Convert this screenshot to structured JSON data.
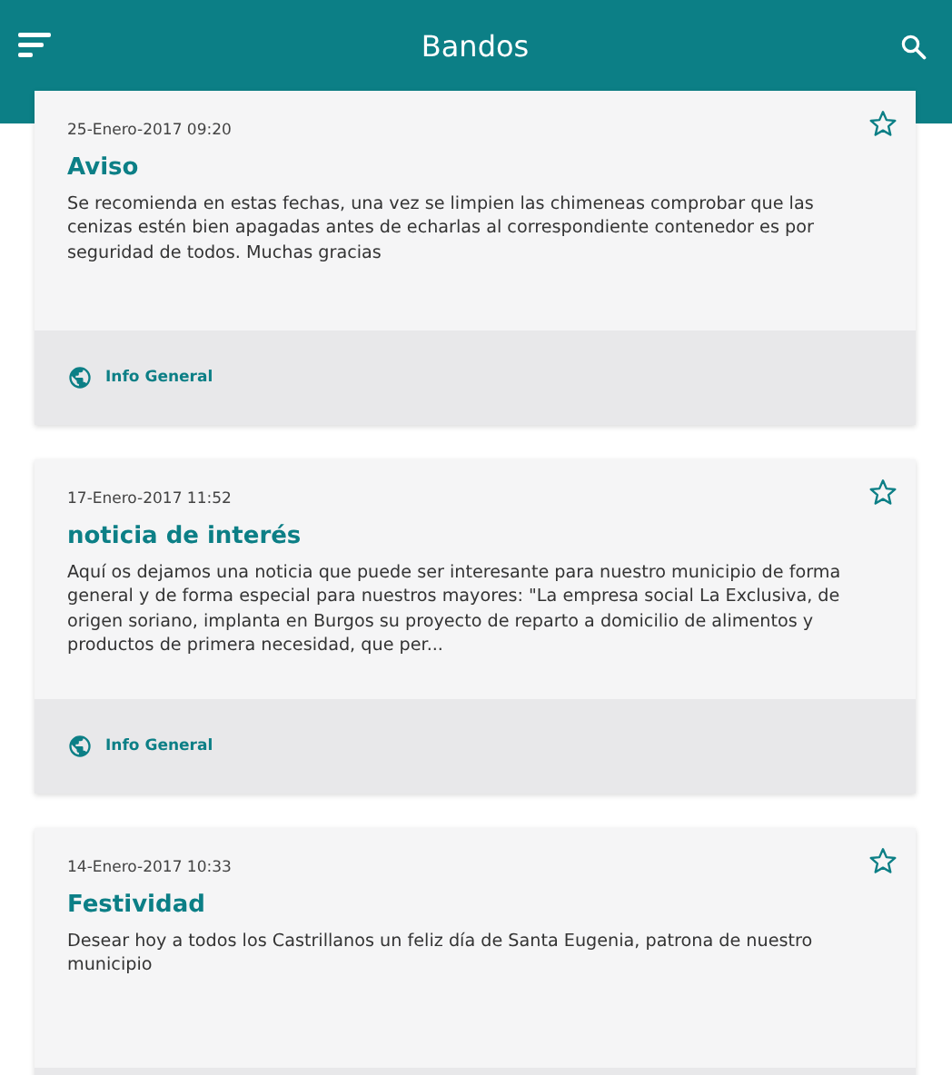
{
  "app_bar": {
    "title": "Bandos"
  },
  "notices": [
    {
      "date": "25-Enero-2017 09:20",
      "title": "Aviso",
      "body": "Se recomienda en estas fechas, una vez se limpien las chimeneas comprobar que las cenizas estén bien apagadas antes de echarlas al correspondiente contenedor es por seguridad de todos. Muchas gracias",
      "favorite": false,
      "category": "Info General"
    },
    {
      "date": "17-Enero-2017 11:52",
      "title": "noticia de interés",
      "body": "Aquí os dejamos una noticia que puede ser interesante para nuestro municipio de forma general y de forma especial para nuestros mayores: \"La empresa social La Exclusiva, de origen soriano, implanta en Burgos su proyecto de reparto a domicilio de alimentos y productos de primera necesidad, que per...",
      "favorite": false,
      "category": "Info General"
    },
    {
      "date": "14-Enero-2017 10:33",
      "title": "Festividad",
      "body": "Desear hoy a todos los Castrillanos un feliz día de Santa Eugenia, patrona de nuestro municipio",
      "favorite": false
    }
  ]
}
